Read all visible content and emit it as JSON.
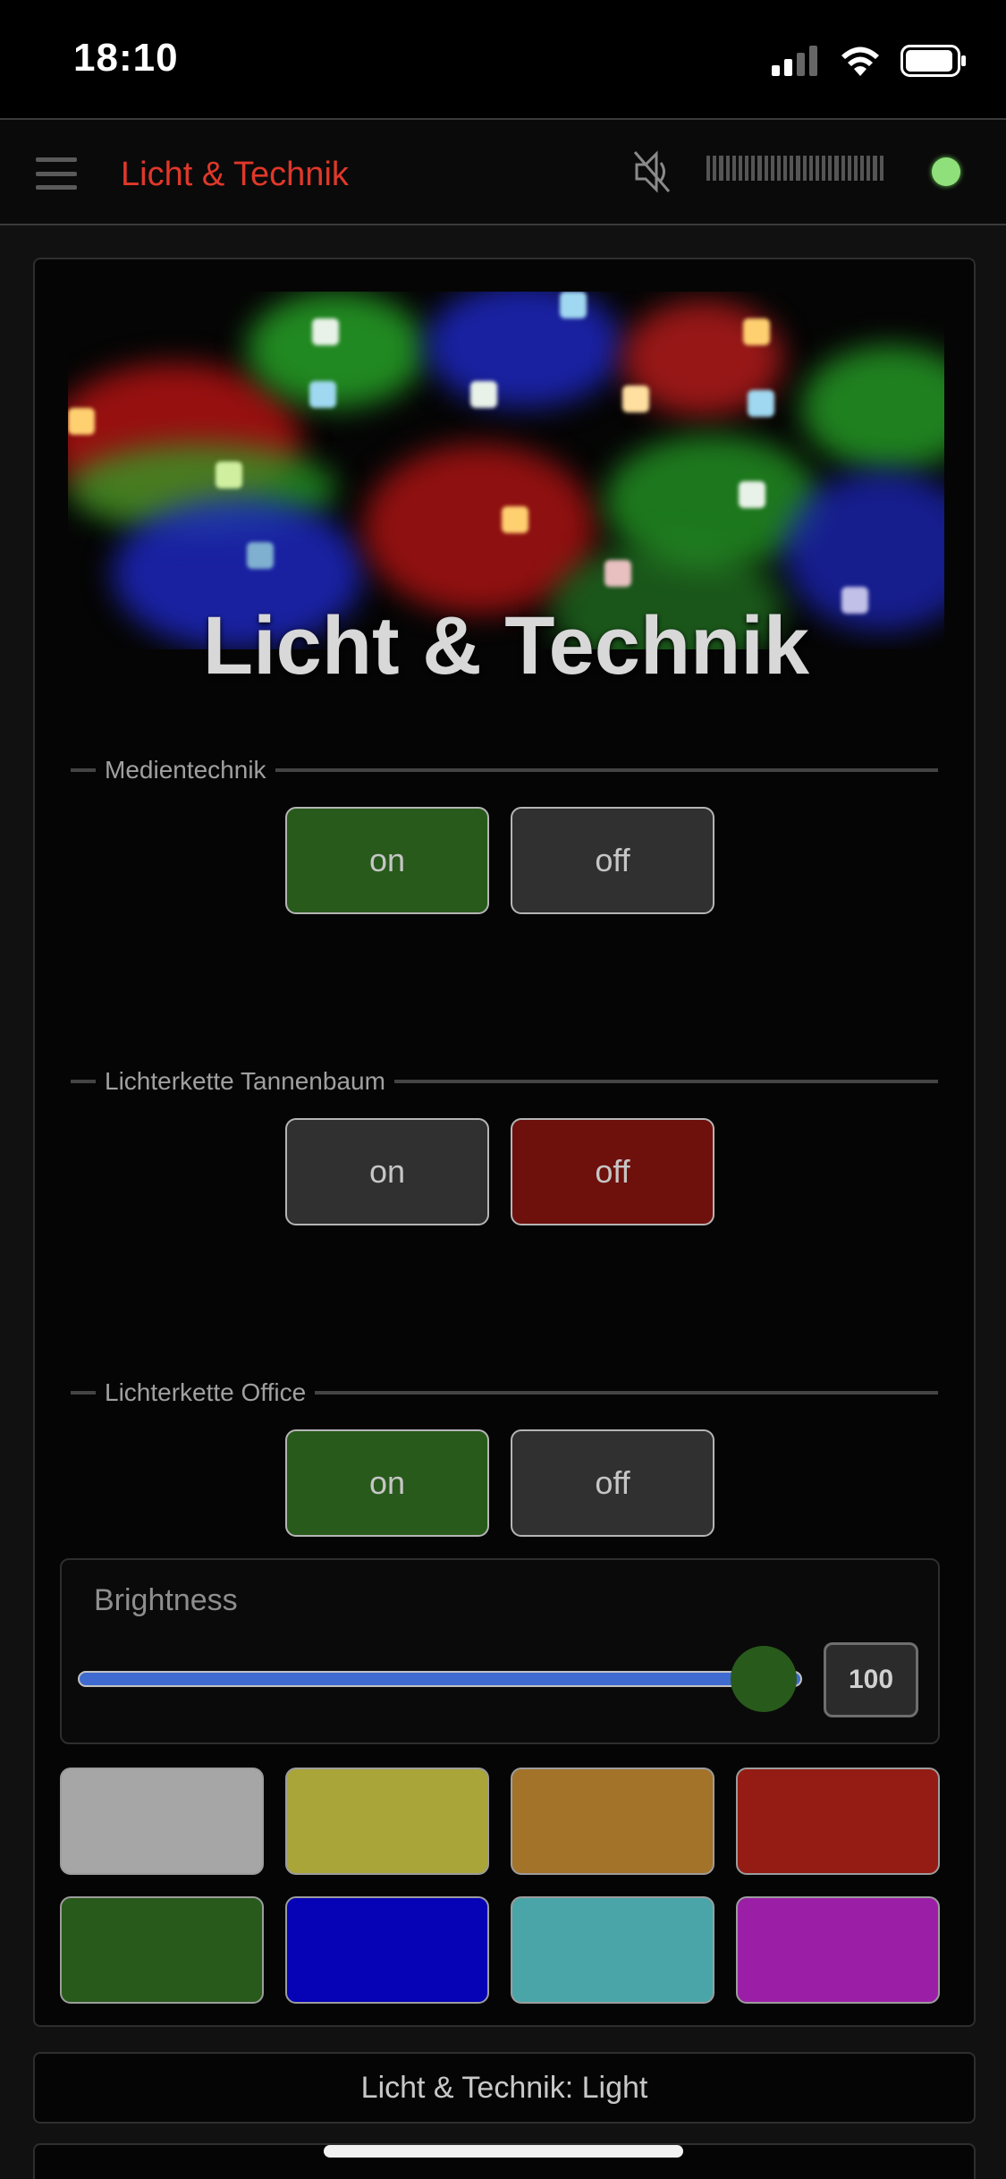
{
  "status_bar": {
    "time": "18:10",
    "icons": [
      "signal-icon",
      "wifi-icon",
      "battery-icon"
    ]
  },
  "header": {
    "menu_icon": "hamburger-menu-icon",
    "title": "Licht & Technik",
    "title_color": "#e0382a",
    "mute_icon": "speaker-muted-icon",
    "connection_status_color": "#8fe07a"
  },
  "hero": {
    "title": "Licht & Technik",
    "image": "rgb-led-strip-image"
  },
  "sections": [
    {
      "label": "Medientechnik",
      "on_label": "on",
      "off_label": "off",
      "state": "on"
    },
    {
      "label": "Lichterkette Tannenbaum",
      "on_label": "on",
      "off_label": "off",
      "state": "off"
    },
    {
      "label": "Lichterkette Office",
      "on_label": "on",
      "off_label": "off",
      "state": "on"
    }
  ],
  "brightness": {
    "label": "Brightness",
    "value": "100",
    "max": 100
  },
  "colors": [
    "#a6a6a6",
    "#a9a538",
    "#a3732a",
    "#941c14",
    "#285a1b",
    "#0602b6",
    "#49a5a8",
    "#9b1fa6"
  ],
  "footer": {
    "label": "Licht & Technik: Light"
  }
}
